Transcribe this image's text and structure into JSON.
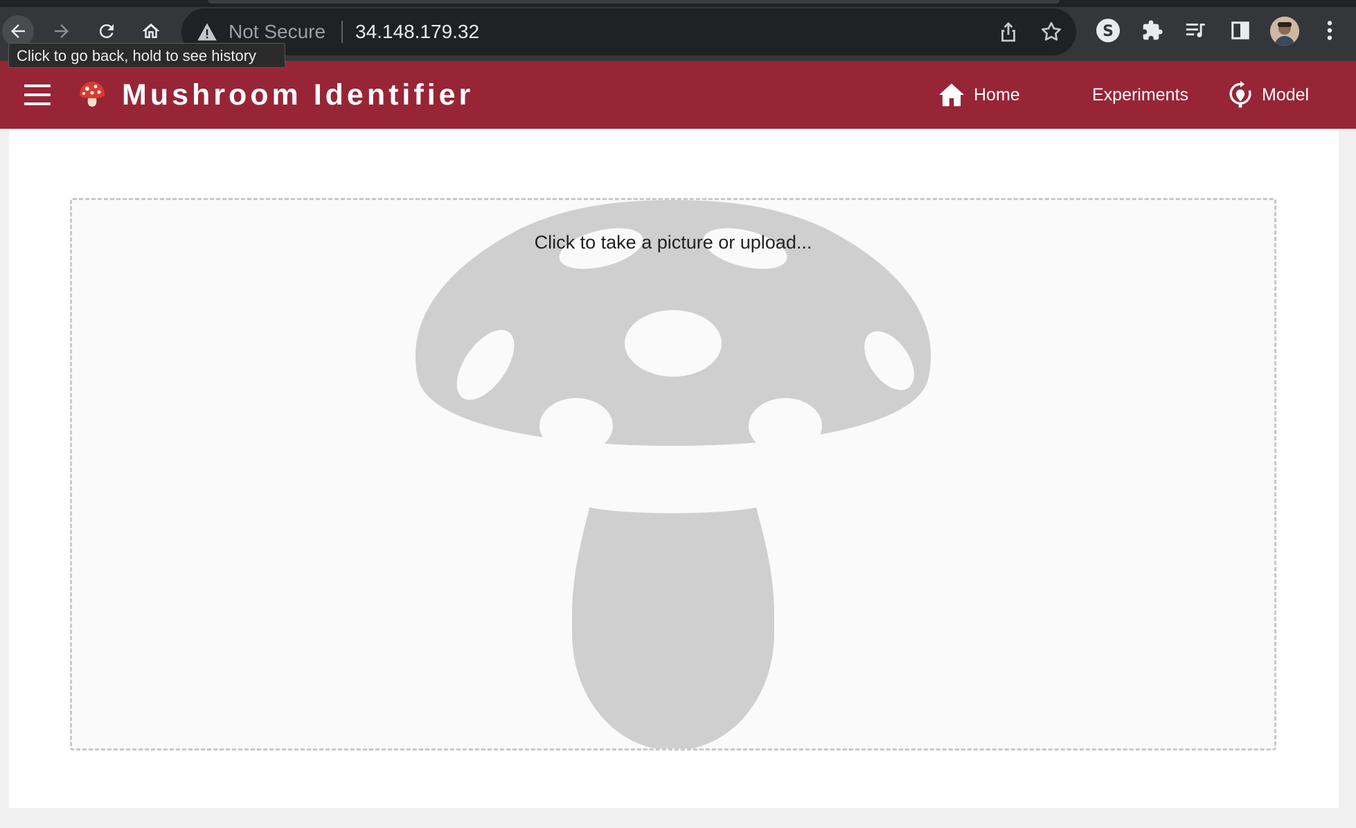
{
  "browser": {
    "security_label": "Not Secure",
    "url": "34.148.179.32",
    "tooltip": "Click to go back, hold to see history"
  },
  "app": {
    "title": "Mushroom Identifier",
    "brand_color": "#972536",
    "nav": {
      "home": "Home",
      "experiments": "Experiments",
      "model": "Model"
    }
  },
  "main": {
    "upload_prompt": "Click to take a picture or upload..."
  }
}
